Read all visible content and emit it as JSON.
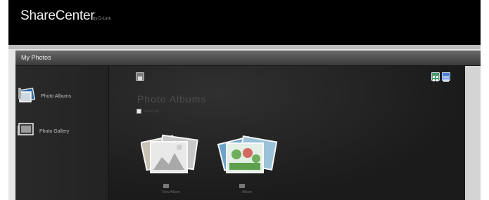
{
  "app": {
    "brand": "ShareCenter",
    "brand_sub": "by D-Link"
  },
  "window": {
    "title": "My Photos"
  },
  "sidebar": {
    "items": [
      {
        "label": "Photo Albums",
        "icon": "photo-albums-icon"
      },
      {
        "label": "Photo Gallery",
        "icon": "photo-gallery-icon"
      }
    ]
  },
  "main": {
    "title": "Photo Albums",
    "select_all_label": "Select All",
    "view_buttons": [
      "grid-view-icon",
      "list-view-icon"
    ],
    "albums": [
      {
        "name": "New Album"
      },
      {
        "name": "Album"
      }
    ]
  },
  "colors": {
    "topbar": "#000000",
    "content_bg": "#1e1e1e",
    "sidebar_bg": "#262626",
    "accent": "#4a7fd4"
  }
}
